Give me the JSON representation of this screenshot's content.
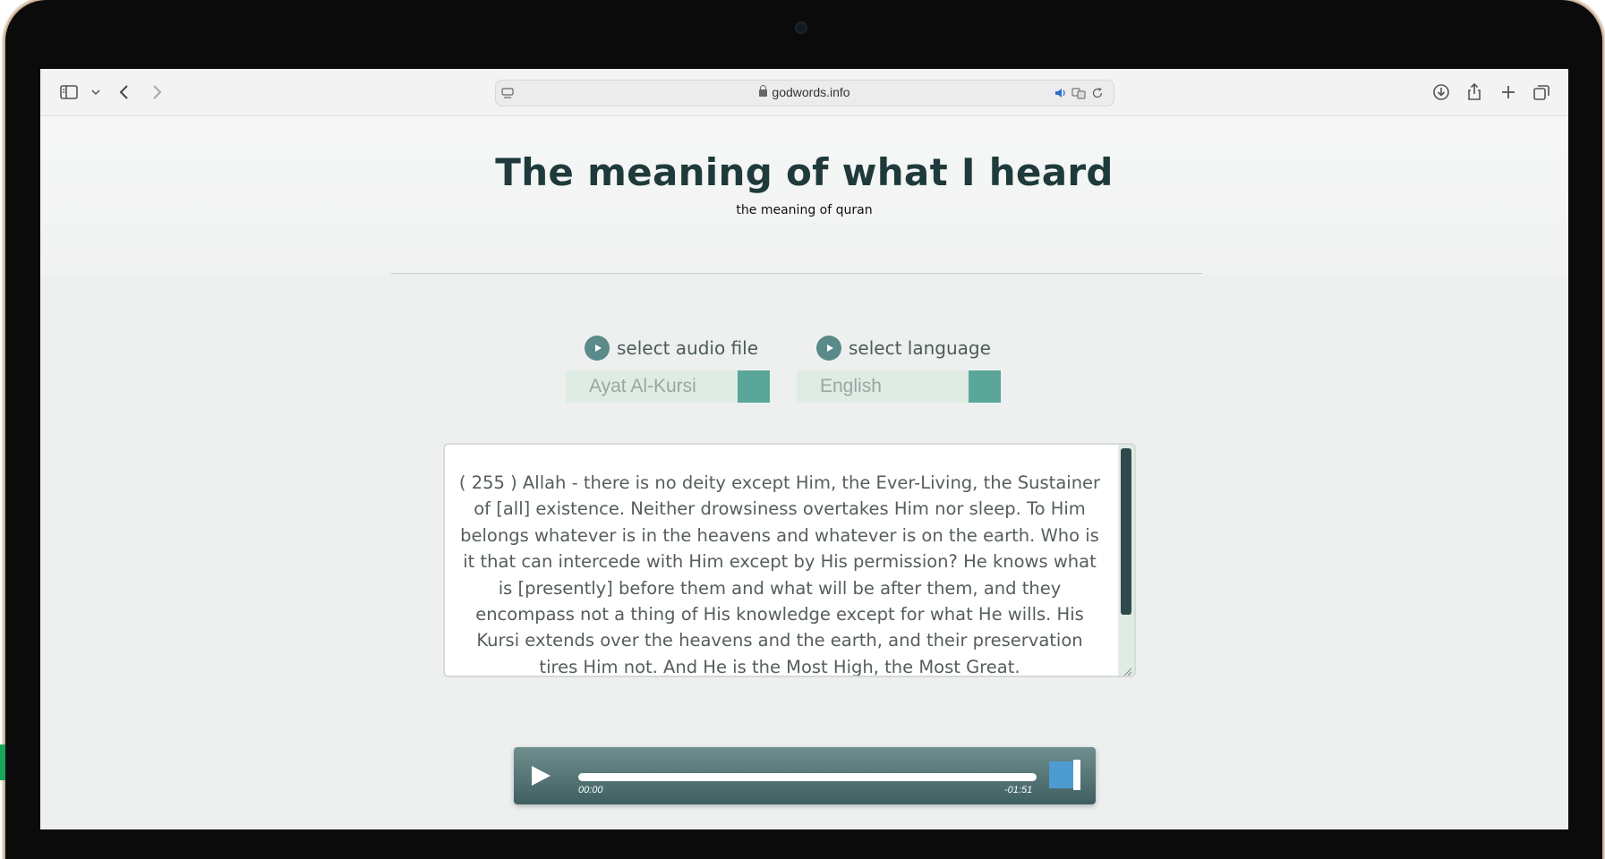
{
  "browser": {
    "url": "godwords.info",
    "icons": [
      "sidebar-icon",
      "chevron-down-icon",
      "back-icon",
      "forward-icon",
      "reader-icon",
      "lock-icon",
      "speaker-icon",
      "translate-icon",
      "reload-icon",
      "download-icon",
      "share-icon",
      "plus-icon",
      "tabs-icon"
    ]
  },
  "header": {
    "title": "The meaning of what I heard",
    "subtitle": "the meaning of quran"
  },
  "audio_select": {
    "label": "select audio file",
    "value": "Ayat Al-Kursi"
  },
  "language_select": {
    "label": "select language",
    "value": "English"
  },
  "verse": {
    "text": "( 255 )   Allah - there is no deity except Him, the Ever-Living, the Sustainer of [all] existence. Neither drowsiness overtakes Him nor sleep. To Him belongs whatever is in the heavens and whatever is on the earth. Who is it that can intercede with Him except by His permission? He knows what is [presently] before them and what will be after them, and they encompass not a thing of His knowledge except for what He wills. His Kursi extends over the heavens and the earth, and their preservation tires Him not. And He is the Most High, the Most Great."
  },
  "player": {
    "current_time": "00:00",
    "remaining_time": "-01:51",
    "progress": 0
  },
  "colors": {
    "title": "#1f3a3a",
    "accent": "#5aa79a",
    "select_bg": "#dfece4",
    "player": "#3e5e60",
    "volume": "#4e9bd0"
  }
}
